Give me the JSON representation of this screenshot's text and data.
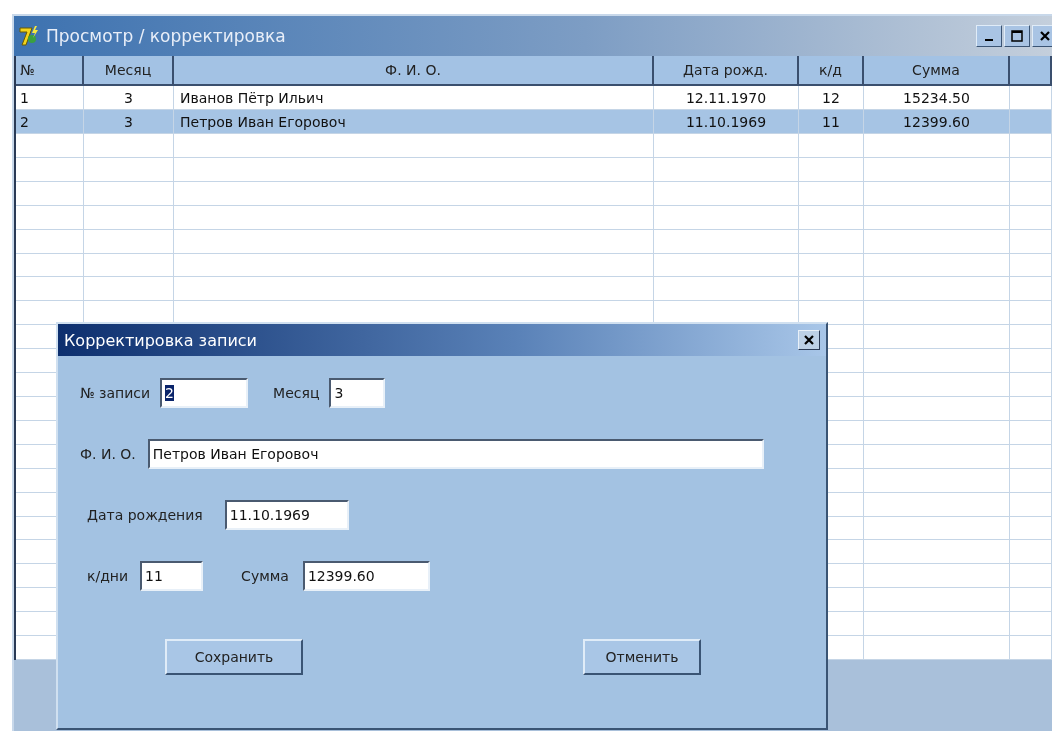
{
  "window": {
    "title": "Просмотр / корректировка"
  },
  "table": {
    "columns": [
      "№",
      "Месяц",
      "Ф. И. О.",
      "Дата рожд.",
      "к/д",
      "Сумма"
    ],
    "rows": [
      {
        "cells": [
          "1",
          "3",
          "Иванов Пётр Ильич",
          "12.11.1970",
          "12",
          "15234.50"
        ],
        "selected": false
      },
      {
        "cells": [
          "2",
          "3",
          "Петров Иван Егоровоч",
          "11.10.1969",
          "11",
          "12399.60"
        ],
        "selected": true
      }
    ]
  },
  "dialog": {
    "title": "Корректировка записи",
    "rows": [
      {
        "fields": [
          {
            "label": "№ записи",
            "value": "2",
            "text_selected": true
          },
          {
            "label": "Месяц",
            "value": "3",
            "text_selected": false
          }
        ]
      },
      {
        "fields": [
          {
            "label": "Ф. И. О.",
            "value": "Петров Иван Егоровоч",
            "text_selected": false
          }
        ]
      },
      {
        "fields": [
          {
            "label": "Дата рождения",
            "value": "11.10.1969",
            "text_selected": false
          }
        ]
      },
      {
        "fields": [
          {
            "label": "к/дни",
            "value": "11",
            "text_selected": false
          },
          {
            "label": "Сумма",
            "value": "12399.60",
            "text_selected": false
          }
        ]
      }
    ],
    "buttons": [
      "Сохранить",
      "Отменить"
    ]
  }
}
